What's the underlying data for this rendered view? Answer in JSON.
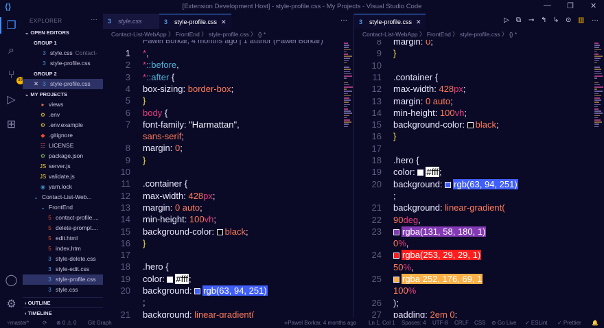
{
  "window": {
    "title": "[Extension Development Host] - style-profile.css - My Projects - Visual Studio Code",
    "app_icon": "vscode-icon"
  },
  "activity_bar": {
    "items": [
      "explorer-icon",
      "search-icon",
      "source-control-icon",
      "run-debug-icon",
      "extensions-icon"
    ],
    "bottom": [
      "account-icon",
      "settings-gear-icon"
    ],
    "scm_badge": "39"
  },
  "sidebar": {
    "title": "EXPLORER",
    "open_editors": "OPEN EDITORS",
    "group1": "GROUP 1",
    "group1_items": [
      {
        "name": "style.css",
        "hint": "Contact-"
      },
      {
        "name": "style-profile.css",
        "hint": ""
      }
    ],
    "group2": "GROUP 2",
    "group2_items": [
      {
        "name": "style-profile.css",
        "hint": ""
      }
    ],
    "project": "MY PROJECTS",
    "tree": [
      {
        "name": "views",
        "type": "folder",
        "indent": 1
      },
      {
        "name": ".env",
        "type": "env",
        "indent": 1
      },
      {
        "name": ".env.example",
        "type": "env",
        "indent": 1
      },
      {
        "name": ".gitignore",
        "type": "git",
        "indent": 1
      },
      {
        "name": "LICENSE",
        "type": "license",
        "indent": 1
      },
      {
        "name": "package.json",
        "type": "json",
        "indent": 1
      },
      {
        "name": "server.js",
        "type": "js",
        "indent": 1
      },
      {
        "name": "validate.js",
        "type": "js",
        "indent": 1
      },
      {
        "name": "yarn.lock",
        "type": "yarn",
        "indent": 1
      },
      {
        "name": "Contact-List-Web...",
        "type": "folder-open",
        "indent": 0
      },
      {
        "name": "FrontEnd",
        "type": "folder-open",
        "indent": 1
      },
      {
        "name": "contact-profile....",
        "type": "html",
        "indent": 2
      },
      {
        "name": "delete-prompt....",
        "type": "html",
        "indent": 2
      },
      {
        "name": "edit.html",
        "type": "html",
        "indent": 2
      },
      {
        "name": "index.htm",
        "type": "html",
        "indent": 2
      },
      {
        "name": "style-delete.css",
        "type": "css",
        "indent": 2
      },
      {
        "name": "style-edit.css",
        "type": "css",
        "indent": 2
      },
      {
        "name": "style-profile.css",
        "type": "css",
        "indent": 2
      },
      {
        "name": "style.css",
        "type": "css",
        "indent": 2
      }
    ],
    "outline": "OUTLINE",
    "timeline": "TIMELINE"
  },
  "editor_left": {
    "tabs": [
      {
        "name": "style.css",
        "active": false
      },
      {
        "name": "style-profile.css",
        "active": true
      }
    ],
    "breadcrumb": "Contact-List-WebApp 〉 FrontEnd 〉 style-profile.css 〉 {} *",
    "blame": "Pawel Borkar, 4 months ago | 1 author (Pawel Borkar)"
  },
  "editor_right": {
    "tabs": [
      {
        "name": "style-profile.css",
        "active": true
      }
    ],
    "breadcrumb": "Contact-List-WebApp 〉 FrontEnd 〉 style-profile.css 〉 {} *"
  },
  "colors": {
    "hero_background": "#3f5efb",
    "gradient_1": "#833ab4",
    "gradient_2": "#fd1d1d",
    "gradient_3": "#fcb045",
    "white": "#ffffff",
    "black": "#000000",
    "accent": "#3f8fff"
  },
  "code_left": [
    {
      "n": "1",
      "tokens": [
        [
          "k",
          "*"
        ],
        [
          "p",
          ","
        ]
      ]
    },
    {
      "n": "2",
      "tokens": [
        [
          "k",
          "*"
        ],
        [
          "pseudo",
          "::before"
        ],
        [
          "p",
          ","
        ]
      ]
    },
    {
      "n": "3",
      "tokens": [
        [
          "k",
          "*"
        ],
        [
          "pseudo",
          "::after"
        ],
        [
          "p",
          " {"
        ]
      ]
    },
    {
      "n": "4",
      "tokens": [
        [
          "p",
          "    box-sizing: "
        ],
        [
          "o",
          "border-box"
        ],
        [
          "p",
          ";"
        ]
      ]
    },
    {
      "n": "5",
      "tokens": [
        [
          "y",
          "}"
        ]
      ]
    },
    {
      "n": "6",
      "tokens": [
        [
          "k",
          "body"
        ],
        [
          "p",
          " {"
        ]
      ]
    },
    {
      "n": "7",
      "tokens": [
        [
          "p",
          "    font-family: "
        ],
        [
          "s",
          "\"Harmattan\""
        ],
        [
          "p",
          ","
        ]
      ]
    },
    {
      "n": "",
      "tokens": [
        [
          "o",
          "    sans-serif"
        ],
        [
          "p",
          ";"
        ]
      ]
    },
    {
      "n": "8",
      "tokens": [
        [
          "p",
          "    margin: "
        ],
        [
          "o",
          "0"
        ],
        [
          "p",
          ";"
        ]
      ]
    },
    {
      "n": "9",
      "tokens": [
        [
          "y",
          "}"
        ]
      ]
    },
    {
      "n": "10",
      "tokens": []
    },
    {
      "n": "11",
      "tokens": [
        [
          "p",
          ".container {"
        ]
      ]
    },
    {
      "n": "12",
      "tokens": [
        [
          "p",
          "    max-width: "
        ],
        [
          "o",
          "428"
        ],
        [
          "k",
          "px"
        ],
        [
          "p",
          ";"
        ]
      ]
    },
    {
      "n": "13",
      "tokens": [
        [
          "p",
          "    margin: "
        ],
        [
          "o",
          "0 auto"
        ],
        [
          "p",
          ";"
        ]
      ]
    },
    {
      "n": "14",
      "tokens": [
        [
          "p",
          "    min-height: "
        ],
        [
          "o",
          "100"
        ],
        [
          "k",
          "vh"
        ],
        [
          "p",
          ";"
        ]
      ]
    },
    {
      "n": "15",
      "tokens": [
        [
          "p",
          "    background-color: "
        ],
        [
          "swatch",
          "black"
        ],
        [
          "o",
          "black"
        ],
        [
          "p",
          ";"
        ]
      ]
    },
    {
      "n": "16",
      "tokens": [
        [
          "y",
          "}"
        ]
      ]
    },
    {
      "n": "17",
      "tokens": []
    },
    {
      "n": "18",
      "tokens": [
        [
          "p",
          ".hero {"
        ]
      ]
    },
    {
      "n": "19",
      "tokens": [
        [
          "p",
          "    color: "
        ],
        [
          "swatch",
          "white"
        ],
        [
          "box-white",
          "#fff"
        ],
        [
          "p",
          ";"
        ]
      ]
    },
    {
      "n": "20",
      "tokens": [
        [
          "p",
          "    background: "
        ],
        [
          "swatch",
          "hero_background"
        ],
        [
          "box-blue",
          "rgb(63, 94, 251)"
        ]
      ]
    },
    {
      "n": "",
      "tokens": [
        [
          "p",
          "    ;"
        ]
      ]
    },
    {
      "n": "21",
      "tokens": [
        [
          "p",
          "    background: "
        ],
        [
          "o",
          "linear-gradient("
        ]
      ]
    }
  ],
  "code_right": [
    {
      "n": "8",
      "tokens": [
        [
          "p",
          "    margin: "
        ],
        [
          "o",
          "0"
        ],
        [
          "p",
          ";"
        ]
      ]
    },
    {
      "n": "9",
      "tokens": [
        [
          "y",
          "}"
        ]
      ]
    },
    {
      "n": "10",
      "tokens": []
    },
    {
      "n": "11",
      "tokens": [
        [
          "p",
          ".container {"
        ]
      ]
    },
    {
      "n": "12",
      "tokens": [
        [
          "p",
          "    max-width: "
        ],
        [
          "o",
          "428"
        ],
        [
          "k",
          "px"
        ],
        [
          "p",
          ";"
        ]
      ]
    },
    {
      "n": "13",
      "tokens": [
        [
          "p",
          "    margin: "
        ],
        [
          "o",
          "0 auto"
        ],
        [
          "p",
          ";"
        ]
      ]
    },
    {
      "n": "14",
      "tokens": [
        [
          "p",
          "    min-height: "
        ],
        [
          "o",
          "100"
        ],
        [
          "k",
          "vh"
        ],
        [
          "p",
          ";"
        ]
      ]
    },
    {
      "n": "15",
      "tokens": [
        [
          "p",
          "    background-color: "
        ],
        [
          "swatch",
          "black"
        ],
        [
          "o",
          "black"
        ],
        [
          "p",
          ";"
        ]
      ]
    },
    {
      "n": "16",
      "tokens": [
        [
          "y",
          "}"
        ]
      ]
    },
    {
      "n": "17",
      "tokens": []
    },
    {
      "n": "18",
      "tokens": [
        [
          "p",
          ".hero {"
        ]
      ]
    },
    {
      "n": "19",
      "tokens": [
        [
          "p",
          "    color: "
        ],
        [
          "swatch",
          "white"
        ],
        [
          "box-white",
          "#fff"
        ],
        [
          "p",
          ";"
        ]
      ]
    },
    {
      "n": "20",
      "tokens": [
        [
          "p",
          "    background: "
        ],
        [
          "swatch",
          "hero_background"
        ],
        [
          "box-blue",
          "rgb(63, 94, 251)"
        ]
      ]
    },
    {
      "n": "",
      "tokens": [
        [
          "p",
          "    ;"
        ]
      ]
    },
    {
      "n": "21",
      "tokens": [
        [
          "p",
          "    background: "
        ],
        [
          "o",
          "linear-gradient("
        ]
      ]
    },
    {
      "n": "22",
      "tokens": [
        [
          "o",
          "        90"
        ],
        [
          "k",
          "deg"
        ],
        [
          "p",
          ","
        ]
      ]
    },
    {
      "n": "23",
      "tokens": [
        [
          "p",
          "        "
        ],
        [
          "swatch",
          "gradient_1"
        ],
        [
          "box-purple",
          "rgba(131, 58, 180, 1)"
        ]
      ]
    },
    {
      "n": "",
      "tokens": [
        [
          "o",
          "        0"
        ],
        [
          "k",
          "%"
        ],
        [
          "p",
          ","
        ]
      ]
    },
    {
      "n": "24",
      "tokens": [
        [
          "p",
          "        "
        ],
        [
          "swatch",
          "gradient_2"
        ],
        [
          "box-red",
          "rgba(253, 29, 29, 1)"
        ]
      ]
    },
    {
      "n": "",
      "tokens": [
        [
          "o",
          "        50"
        ],
        [
          "k",
          "%"
        ],
        [
          "p",
          ","
        ]
      ]
    },
    {
      "n": "25",
      "tokens": [
        [
          "p",
          "        "
        ],
        [
          "swatch",
          "gradient_3"
        ],
        [
          "box-orange",
          "rgba 252, 176, 69, 1"
        ]
      ]
    },
    {
      "n": "",
      "tokens": [
        [
          "o",
          "        100"
        ],
        [
          "k",
          "%"
        ]
      ]
    },
    {
      "n": "26",
      "tokens": [
        [
          "p",
          "    );"
        ]
      ]
    },
    {
      "n": "27",
      "tokens": [
        [
          "p",
          "    padding: "
        ],
        [
          "o",
          "2em 0"
        ],
        [
          "p",
          ";"
        ]
      ]
    }
  ],
  "status": {
    "branch": "master*",
    "sync": "⟳",
    "problems": "⊗ 0 ⚠ 0",
    "git_graph": "Git Graph",
    "blame": "Pawel Borkar, 4 months ago",
    "position": "Ln 1, Col 1",
    "spaces": "Spaces: 4",
    "encoding": "UTF-8",
    "eol": "CRLF",
    "language": "CSS",
    "golive": "⊘ Go Live",
    "eslint": "✓ ESLint",
    "prettier": "✓ Prettier",
    "bell": "🔔"
  }
}
